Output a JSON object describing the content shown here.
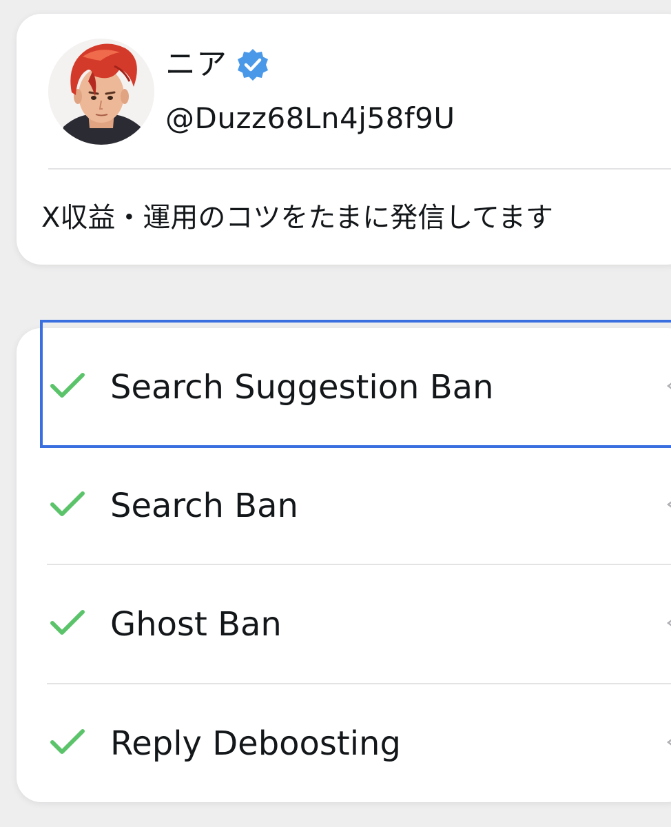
{
  "profile": {
    "display_name": "ニア",
    "verified_icon": "verified-badge-icon",
    "handle": "@Duzz68Ln4j58f9U",
    "bio": "X収益・運用のコツをたまに発信してます",
    "avatar": "anime-red-hair-avatar"
  },
  "checks": [
    {
      "label": "Search Suggestion Ban",
      "status": "pass",
      "icon": "checkmark-icon"
    },
    {
      "label": "Search Ban",
      "status": "pass",
      "icon": "checkmark-icon"
    },
    {
      "label": "Ghost Ban",
      "status": "pass",
      "icon": "checkmark-icon"
    },
    {
      "label": "Reply Deboosting",
      "status": "pass",
      "icon": "checkmark-icon"
    }
  ],
  "colors": {
    "background": "#eeeeef",
    "card": "#ffffff",
    "text": "#14171a",
    "check_green": "#5bc46a",
    "verified_blue": "#4a99e9",
    "focus_blue": "#3a6fe0",
    "divider": "#e3e3e5"
  }
}
